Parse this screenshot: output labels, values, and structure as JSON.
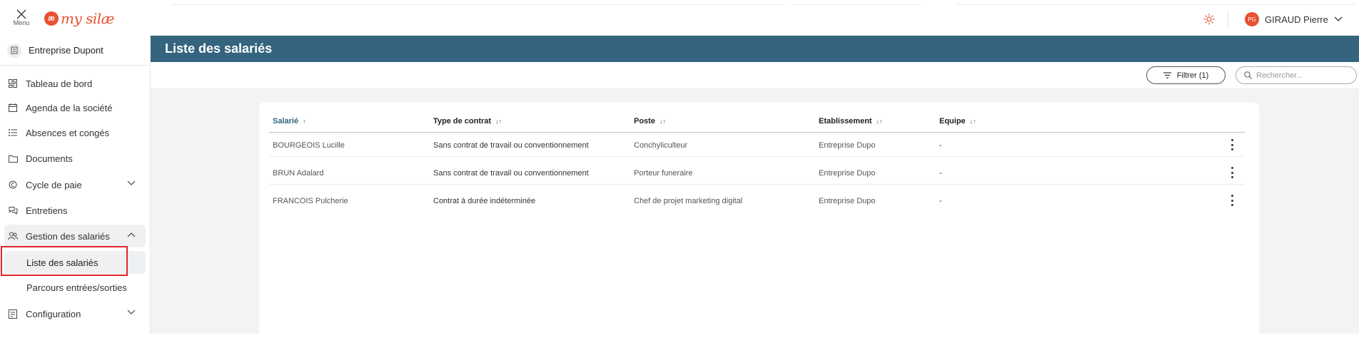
{
  "header": {
    "menu_label": "Menu",
    "logo_text": "my silæ",
    "logo_mark": "æ",
    "user": {
      "initials": "PG",
      "name": "GIRAUD Pierre"
    }
  },
  "sidebar": {
    "company": "Entreprise Dupont",
    "items": [
      {
        "label": "Tableau de bord",
        "icon": "dashboard-icon"
      },
      {
        "label": "Agenda de la société",
        "icon": "calendar-icon"
      },
      {
        "label": "Absences et congés",
        "icon": "list-icon"
      },
      {
        "label": "Documents",
        "icon": "folder-icon"
      },
      {
        "label": "Cycle de paie",
        "icon": "payroll-icon"
      },
      {
        "label": "Entretiens",
        "icon": "interview-icon"
      },
      {
        "label": "Gestion des salariés",
        "icon": "people-icon"
      },
      {
        "label": "Liste des salariés"
      },
      {
        "label": "Parcours entrées/sorties"
      },
      {
        "label": "Configuration",
        "icon": "config-icon"
      }
    ]
  },
  "main": {
    "title": "Liste des salariés",
    "filter_label": "Filtrer (1)",
    "search_placeholder": "Rechercher...",
    "columns": [
      "Salarié",
      "Type de contrat",
      "Poste",
      "Etablissement",
      "Equipe"
    ],
    "rows": [
      [
        "BOURGEOIS Lucille",
        "Sans contrat de travail ou conventionnement",
        "Conchyliculteur",
        "Entreprise Dupo",
        "-"
      ],
      [
        "BRUN Adalard",
        "Sans contrat de travail ou conventionnement",
        "Porteur funeraire",
        "Entreprise Dupo",
        "-"
      ],
      [
        "FRANCOIS Pulcherie",
        "Contrat à durée indéterminée",
        "Chef de projet marketing digital",
        "Entreprise Dupo",
        "-"
      ]
    ]
  },
  "colors": {
    "accent": "#34647e",
    "brand": "#e85032",
    "highlight": "#e0262b"
  }
}
